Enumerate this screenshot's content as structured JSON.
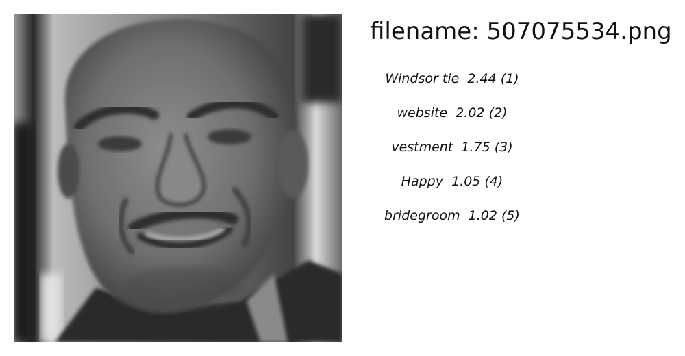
{
  "filename_text": "filename: 507075534.png",
  "photo": {
    "description_icon": "face-photo",
    "tones": {
      "background_dark": "#1a1a1a",
      "background_light": "#d8d8d8",
      "skin": "#7d7d7d",
      "skin_highlight": "#9a9a9a",
      "shadow": "#3a3a3a"
    }
  },
  "predictions": [
    {
      "label": "Windsor tie",
      "score": "2.44 (1)"
    },
    {
      "label": "website",
      "score": "2.02 (2)"
    },
    {
      "label": "vestment",
      "score": "1.75 (3)"
    },
    {
      "label": "Happy",
      "score": "1.05 (4)"
    },
    {
      "label": "bridegroom",
      "score": "1.02 (5)"
    }
  ]
}
